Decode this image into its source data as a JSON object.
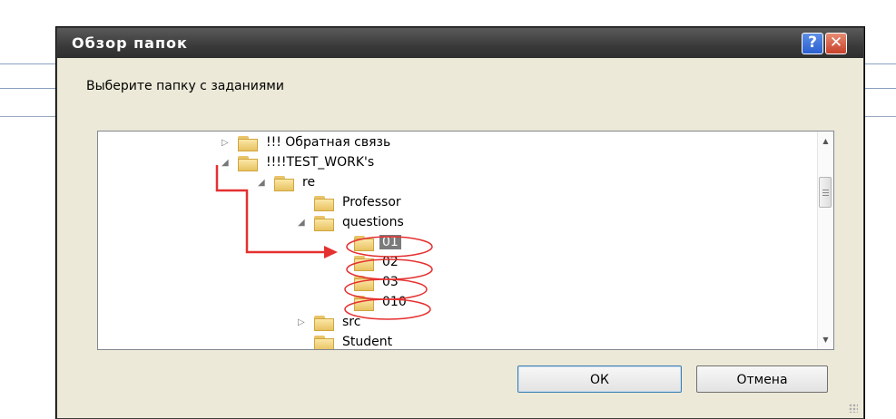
{
  "dialog": {
    "title": "Обзор папок",
    "help_label": "?",
    "close_label": "✕",
    "prompt": "Выберите папку с заданиями"
  },
  "tree": {
    "items": [
      {
        "label": "!!! Обратная связь",
        "toggle": "▷"
      },
      {
        "label": "!!!!TEST_WORK's",
        "toggle": "◢"
      },
      {
        "label": "re",
        "toggle": "◢"
      },
      {
        "label": "Professor",
        "toggle": ""
      },
      {
        "label": "questions",
        "toggle": "◢"
      },
      {
        "label": "01",
        "toggle": "",
        "selected": true
      },
      {
        "label": "02",
        "toggle": ""
      },
      {
        "label": "03",
        "toggle": ""
      },
      {
        "label": "010",
        "toggle": ""
      },
      {
        "label": "src",
        "toggle": "▷"
      },
      {
        "label": "Student",
        "toggle": ""
      }
    ],
    "scroll_up": "▲",
    "scroll_down": "▼"
  },
  "buttons": {
    "ok": "ОК",
    "cancel": "Отмена"
  },
  "colors": {
    "annotation": "#e53030",
    "selection": "#7b7b7b",
    "titlebar": "#3a3a3a"
  }
}
